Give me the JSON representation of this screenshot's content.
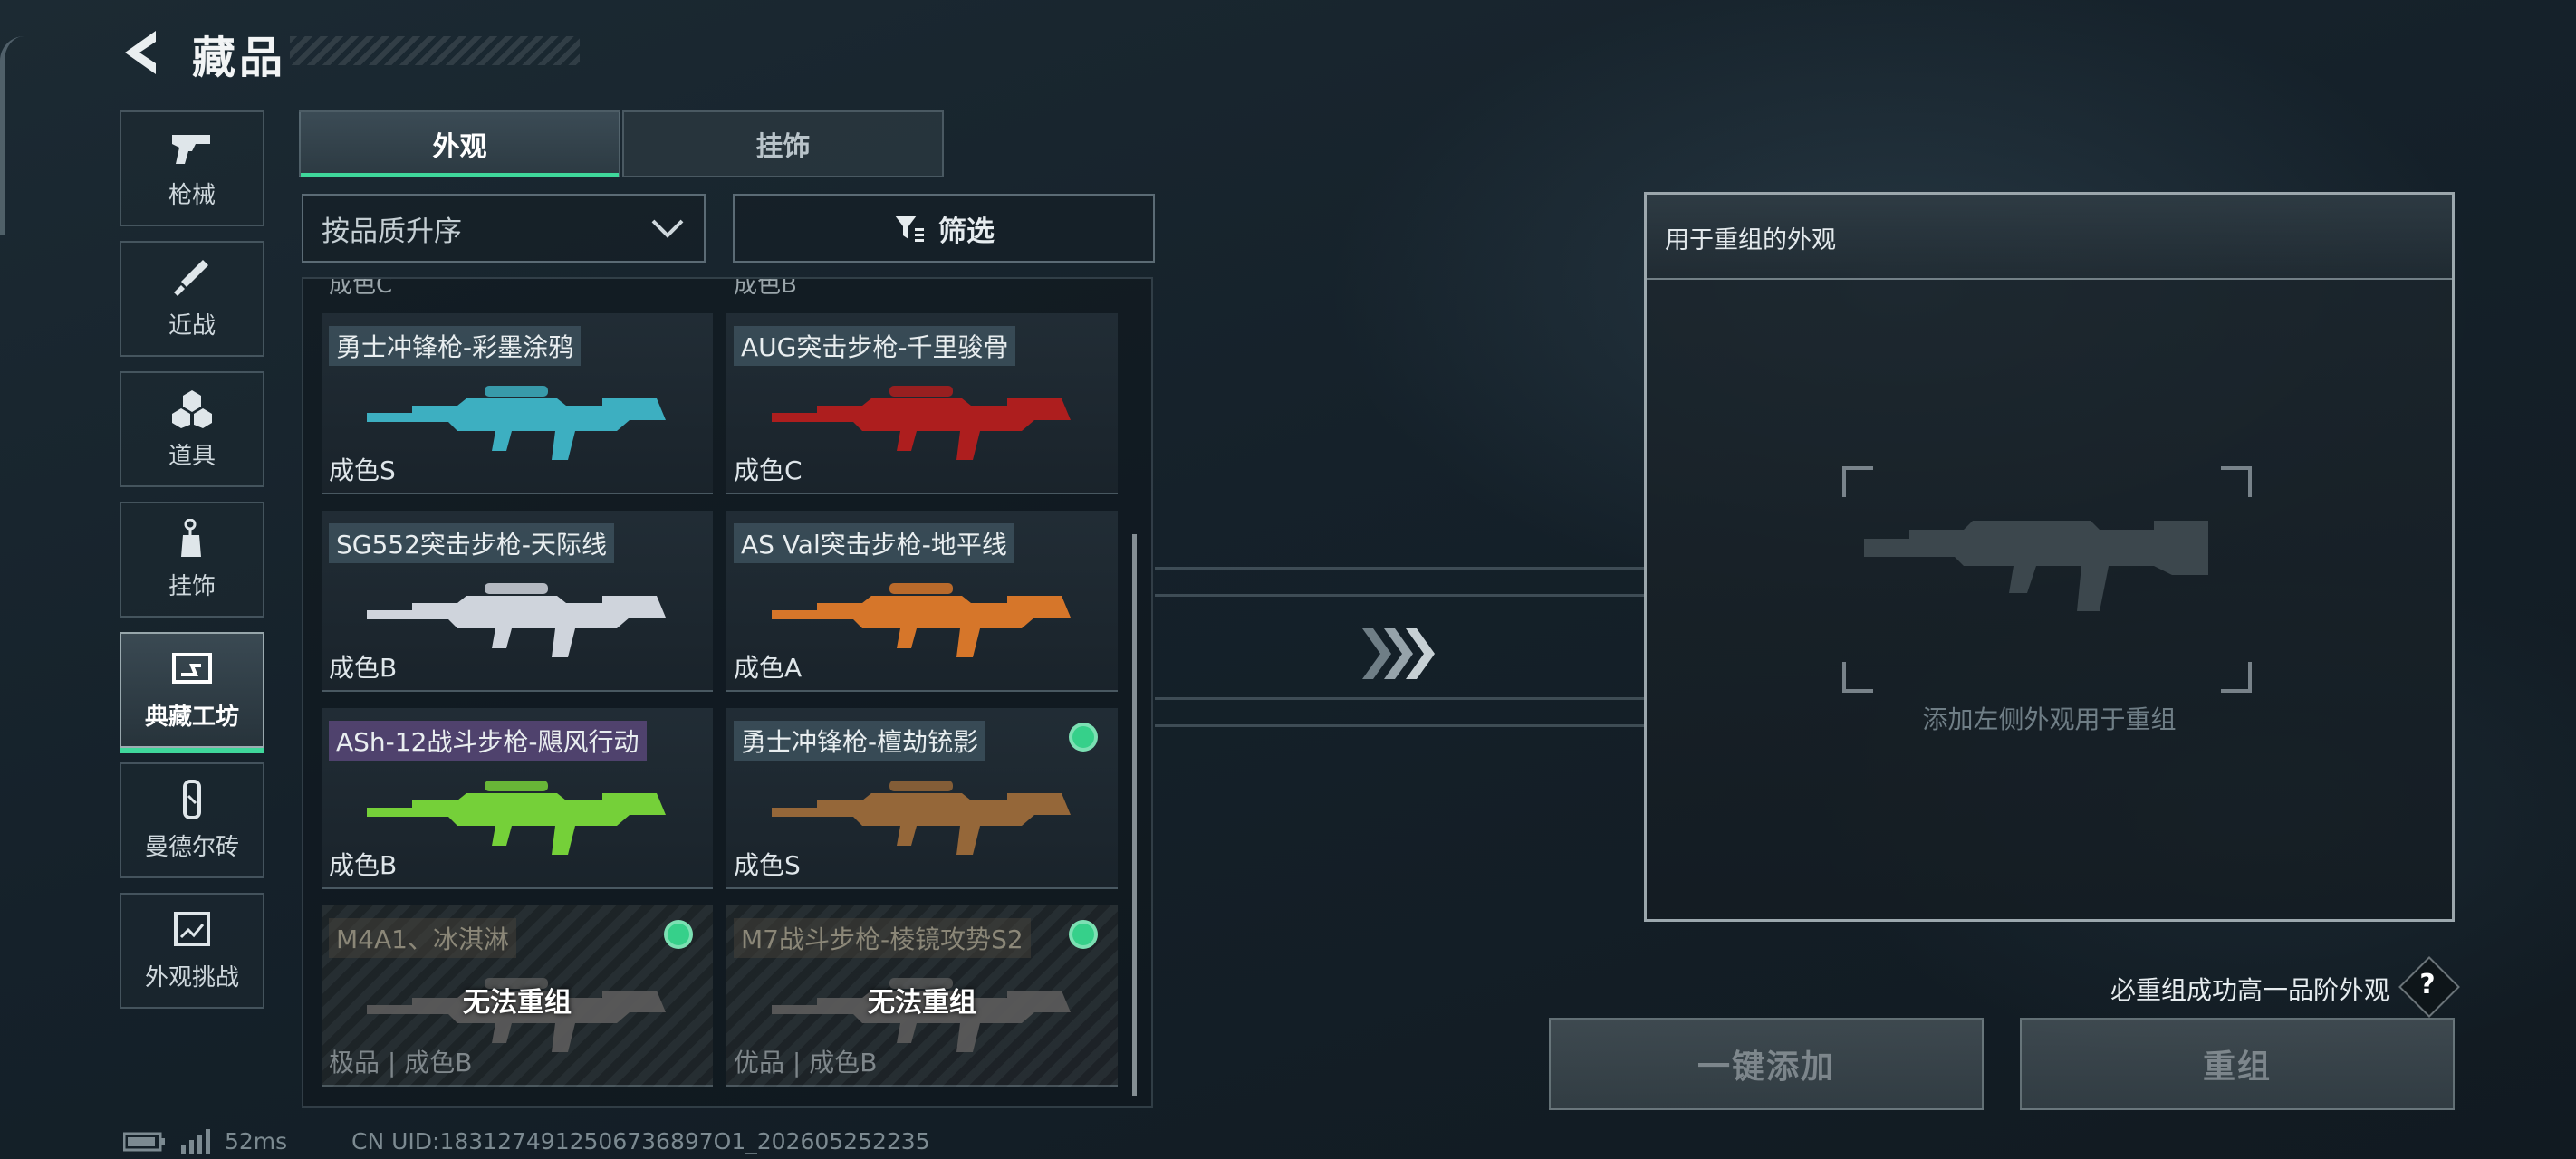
{
  "header": {
    "title": "藏品"
  },
  "sidebar": {
    "items": [
      {
        "label": "枪械",
        "icon": "pistol-icon"
      },
      {
        "label": "近战",
        "icon": "knife-icon"
      },
      {
        "label": "道具",
        "icon": "boxes-icon"
      },
      {
        "label": "挂饰",
        "icon": "charm-icon"
      },
      {
        "label": "典藏工坊",
        "icon": "workshop-icon",
        "active": true
      },
      {
        "label": "曼德尔砖",
        "icon": "brick-icon"
      },
      {
        "label": "外观挑战",
        "icon": "challenge-icon"
      }
    ]
  },
  "tabs": [
    {
      "label": "外观",
      "active": true
    },
    {
      "label": "挂饰",
      "active": false
    }
  ],
  "sort": {
    "selected": "按品质升序"
  },
  "filter": {
    "label": "筛选"
  },
  "grid": {
    "partial_top": [
      "成色C",
      "成色B"
    ],
    "items": [
      {
        "name": "勇士冲锋枪-彩墨涂鸦",
        "grade": "成色S",
        "tag_color": "blue",
        "gun_color": "#3fb6c9",
        "selected": false,
        "locked": false
      },
      {
        "name": "AUG突击步枪-千里骏骨",
        "grade": "成色C",
        "tag_color": "blue",
        "gun_color": "#b51d1d",
        "selected": false,
        "locked": false
      },
      {
        "name": "SG552突击步枪-天际线",
        "grade": "成色B",
        "tag_color": "blue",
        "gun_color": "#d9dde6",
        "selected": false,
        "locked": false
      },
      {
        "name": "AS Val突击步枪-地平线",
        "grade": "成色A",
        "tag_color": "blue",
        "gun_color": "#e07a2a",
        "selected": false,
        "locked": false
      },
      {
        "name": "ASh-12战斗步枪-飓风行动",
        "grade": "成色B",
        "tag_color": "purple",
        "gun_color": "#7ad93a",
        "selected": false,
        "locked": false
      },
      {
        "name": "勇士冲锋枪-檀劫铳影",
        "grade": "成色S",
        "tag_color": "blue",
        "gun_color": "#9c6a3a",
        "selected": true,
        "locked": false
      },
      {
        "name": "M4A1、冰淇淋",
        "grade": "极品 | 成色B",
        "tag_color": "gold",
        "gun_color": "#5a5a5a",
        "selected": true,
        "locked": true,
        "locked_label": "无法重组"
      },
      {
        "name": "M7战斗步枪-棱镜攻势S2",
        "grade": "优品 | 成色B",
        "tag_color": "gold",
        "gun_color": "#5a5a5a",
        "selected": true,
        "locked": true,
        "locked_label": "无法重组"
      }
    ]
  },
  "recompose": {
    "title": "用于重组的外观",
    "hint": "添加左侧外观用于重组",
    "guarantee": "必重组成功高一品阶外观",
    "help": "?",
    "add_all_button": "一键添加",
    "recompose_button": "重组"
  },
  "status": {
    "ping": "52ms",
    "uid": "CN UID:1831274912506736897O1_202605252235"
  },
  "colors": {
    "accent": "#3fd79b",
    "selected_dot": "#36d08a"
  }
}
